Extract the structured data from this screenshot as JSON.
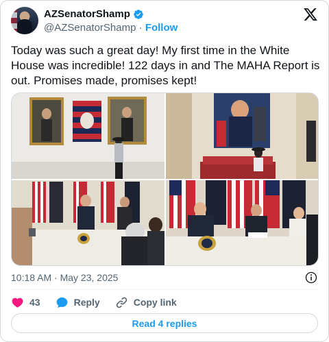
{
  "author": {
    "display_name": "AZSenatorShamp",
    "handle": "@AZSenatorShamp",
    "separator": "·",
    "follow_label": "Follow",
    "verified": true
  },
  "tweet": {
    "text": "Today was such a great day! My first time in the White House was incredible! 122 days in and The MAHA Report is out. Promises made, promises kept!",
    "timestamp": "10:18 AM · May 23, 2025",
    "photo_count": 4
  },
  "actions": {
    "likes_count": "43",
    "reply_label": "Reply",
    "copy_link_label": "Copy link"
  },
  "read_replies_label": "Read 4 replies",
  "colors": {
    "accent": "#1d9bf0",
    "like": "#f91880",
    "secondary_text": "#536471",
    "border": "#cfd9de"
  },
  "icons": [
    "verified-badge-icon",
    "x-logo-icon",
    "info-icon",
    "heart-icon",
    "reply-bubble-icon",
    "copy-link-icon"
  ]
}
